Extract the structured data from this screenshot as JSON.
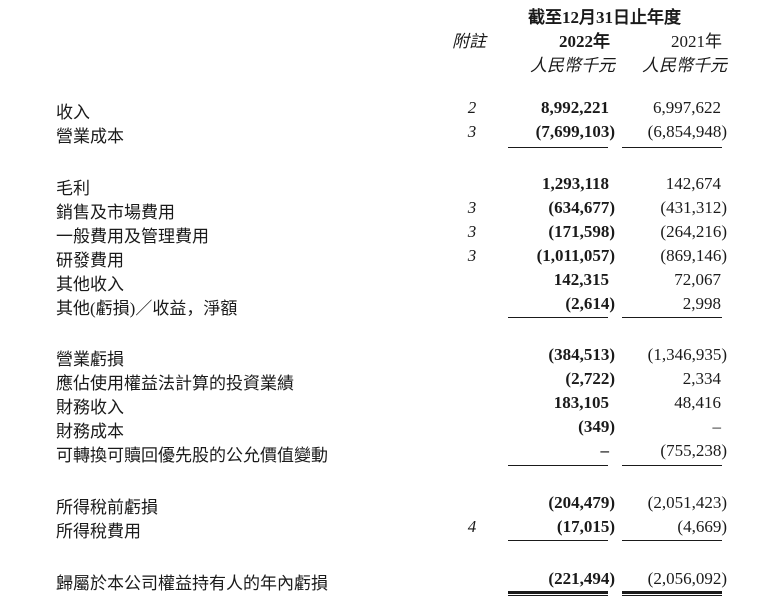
{
  "header": {
    "period": "截至12月31日止年度",
    "note_col": "附註",
    "year_2022": "2022年",
    "year_2021": "2021年",
    "unit_2022": "人民幣千元",
    "unit_2021": "人民幣千元"
  },
  "rows": [
    {
      "label": "收入",
      "note": "2",
      "v2022": "8,992,221",
      "v2021": "6,997,622"
    },
    {
      "label": "營業成本",
      "note": "3",
      "v2022": "(7,699,103)",
      "v2021": "(6,854,948)"
    },
    {
      "label": "毛利",
      "note": "",
      "v2022": "1,293,118",
      "v2021": "142,674"
    },
    {
      "label": "銷售及市場費用",
      "note": "3",
      "v2022": "(634,677)",
      "v2021": "(431,312)"
    },
    {
      "label": "一般費用及管理費用",
      "note": "3",
      "v2022": "(171,598)",
      "v2021": "(264,216)"
    },
    {
      "label": "研發費用",
      "note": "3",
      "v2022": "(1,011,057)",
      "v2021": "(869,146)"
    },
    {
      "label": "其他收入",
      "note": "",
      "v2022": "142,315",
      "v2021": "72,067"
    },
    {
      "label": "其他(虧損)／收益，淨額",
      "note": "",
      "v2022": "(2,614)",
      "v2021": "2,998"
    },
    {
      "label": "營業虧損",
      "note": "",
      "v2022": "(384,513)",
      "v2021": "(1,346,935)"
    },
    {
      "label": "應佔使用權益法計算的投資業績",
      "note": "",
      "v2022": "(2,722)",
      "v2021": "2,334"
    },
    {
      "label": "財務收入",
      "note": "",
      "v2022": "183,105",
      "v2021": "48,416"
    },
    {
      "label": "財務成本",
      "note": "",
      "v2022": "(349)",
      "v2021": "–"
    },
    {
      "label": "可轉換可贖回優先股的公允價值變動",
      "note": "",
      "v2022": "–",
      "v2021": "(755,238)"
    },
    {
      "label": "所得稅前虧損",
      "note": "",
      "v2022": "(204,479)",
      "v2021": "(2,051,423)"
    },
    {
      "label": "所得稅費用",
      "note": "4",
      "v2022": "(17,015)",
      "v2021": "(4,669)"
    },
    {
      "label": "歸屬於本公司權益持有人的年內虧損",
      "note": "",
      "v2022": "(221,494)",
      "v2021": "(2,056,092)"
    }
  ]
}
